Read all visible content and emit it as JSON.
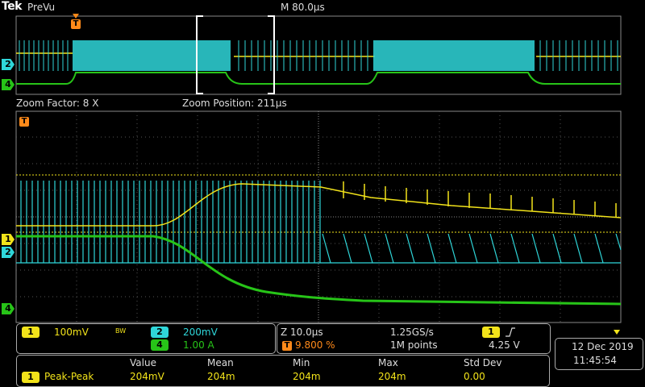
{
  "header": {
    "brand": "Tek",
    "mode": "PreVu",
    "horizontal_scale": "M 80.0µs"
  },
  "zoom": {
    "factor_label": "Zoom Factor: 8 X",
    "position_label": "Zoom Position: 211µs"
  },
  "trigger_marker": "T",
  "channel_markers": {
    "ch1": "1",
    "ch2": "2",
    "ch4": "4"
  },
  "channels": {
    "ch1": {
      "number": "1",
      "scale": "100mV",
      "bw_icon": "BW",
      "color": "#f2e31a"
    },
    "ch2": {
      "number": "2",
      "scale": "200mV",
      "color": "#2fd6d9"
    },
    "ch4": {
      "number": "4",
      "scale": "1.00 A",
      "color": "#27c418"
    }
  },
  "timebase": {
    "zoom_scale": "Z 10.0µs",
    "sample_rate": "1.25GS/s",
    "trigger_position": "9.800 %",
    "record_length": "1M points",
    "trigger_channel": "1",
    "trigger_slope_icon": "rising-edge-icon",
    "trigger_level": "4.25 V"
  },
  "datetime": {
    "date": "12 Dec  2019",
    "time": "11:45:54"
  },
  "measurements": {
    "headers": [
      "Value",
      "Mean",
      "Min",
      "Max",
      "Std Dev"
    ],
    "rows": [
      {
        "channel": "1",
        "name": "Peak-Peak",
        "value": "204mV",
        "mean": "204m",
        "min": "204m",
        "max": "204m",
        "std_dev": "0.00"
      }
    ]
  }
}
